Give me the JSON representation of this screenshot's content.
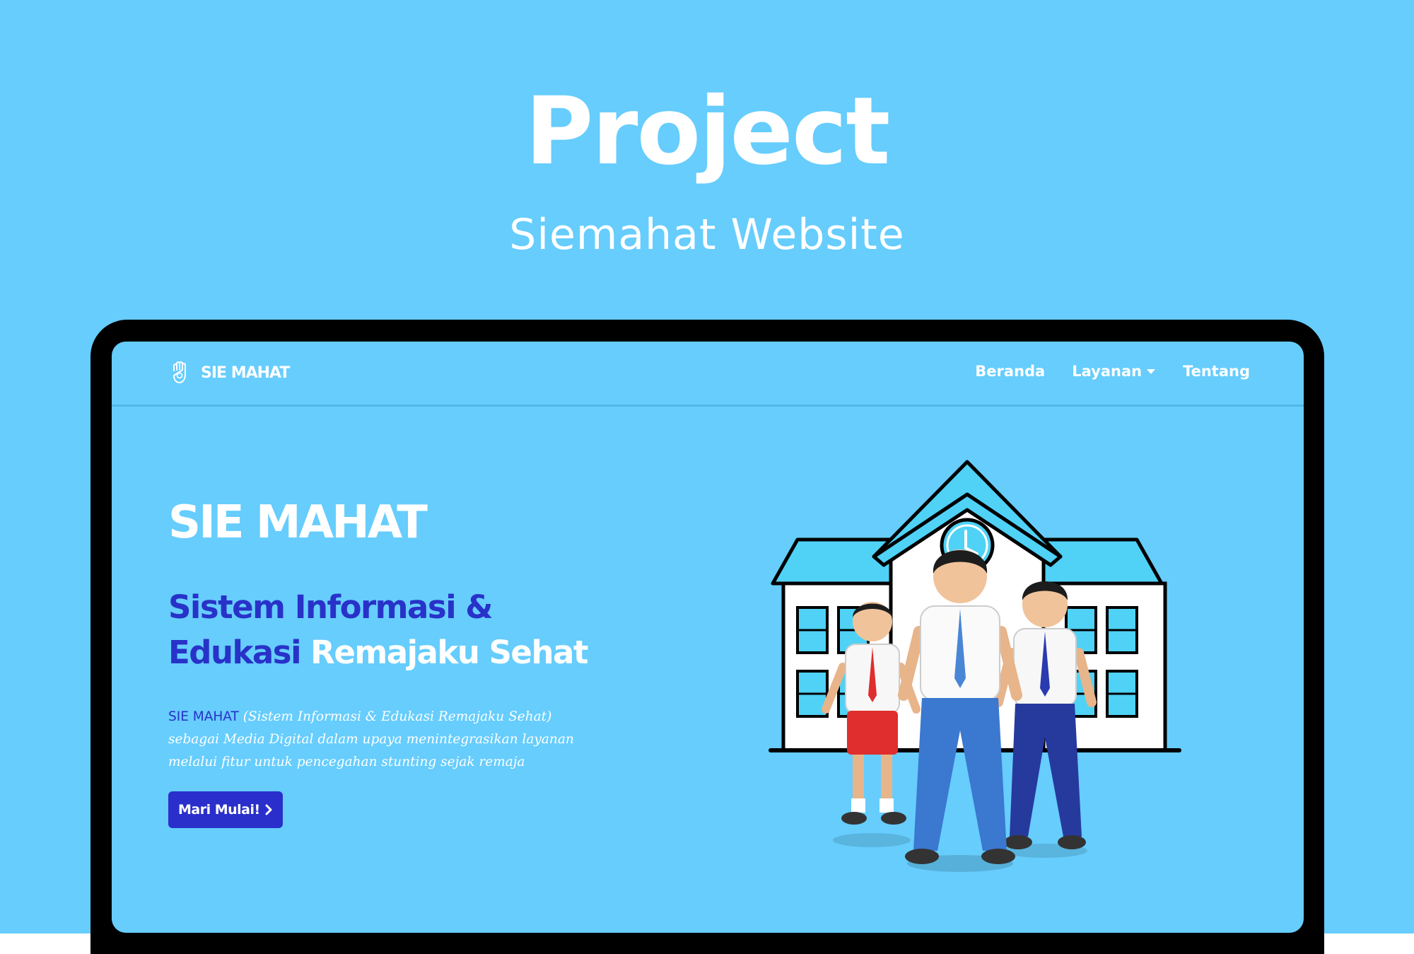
{
  "header": {
    "title": "Project",
    "subtitle": "Siemahat Website"
  },
  "site": {
    "brand": "SIE MAHAT",
    "nav": {
      "home": "Beranda",
      "services": "Layanan",
      "about": "Tentang"
    },
    "hero": {
      "title": "SIE MAHAT",
      "subtitle_line1": "Sistem Informasi &",
      "subtitle_line2_a": "Edukasi",
      "subtitle_line2_b": "Remajaku Sehat",
      "description_highlight": "SIE MAHAT",
      "description_rest": "(Sistem Informasi & Edukasi Remajaku Sehat) sebagai Media Digital dalam upaya menintegrasikan layanan melalui fitur untuk pencegahan stunting sejak remaja",
      "cta": "Mari Mulai!"
    }
  },
  "colors": {
    "background": "#66cdfd",
    "accent": "#2832c8",
    "roof": "#4fd2f6",
    "frame": "#000000"
  },
  "icons": {
    "brand": "hand-logo-icon",
    "caret": "caret-down-icon",
    "cta": "chevron-right-icon"
  }
}
